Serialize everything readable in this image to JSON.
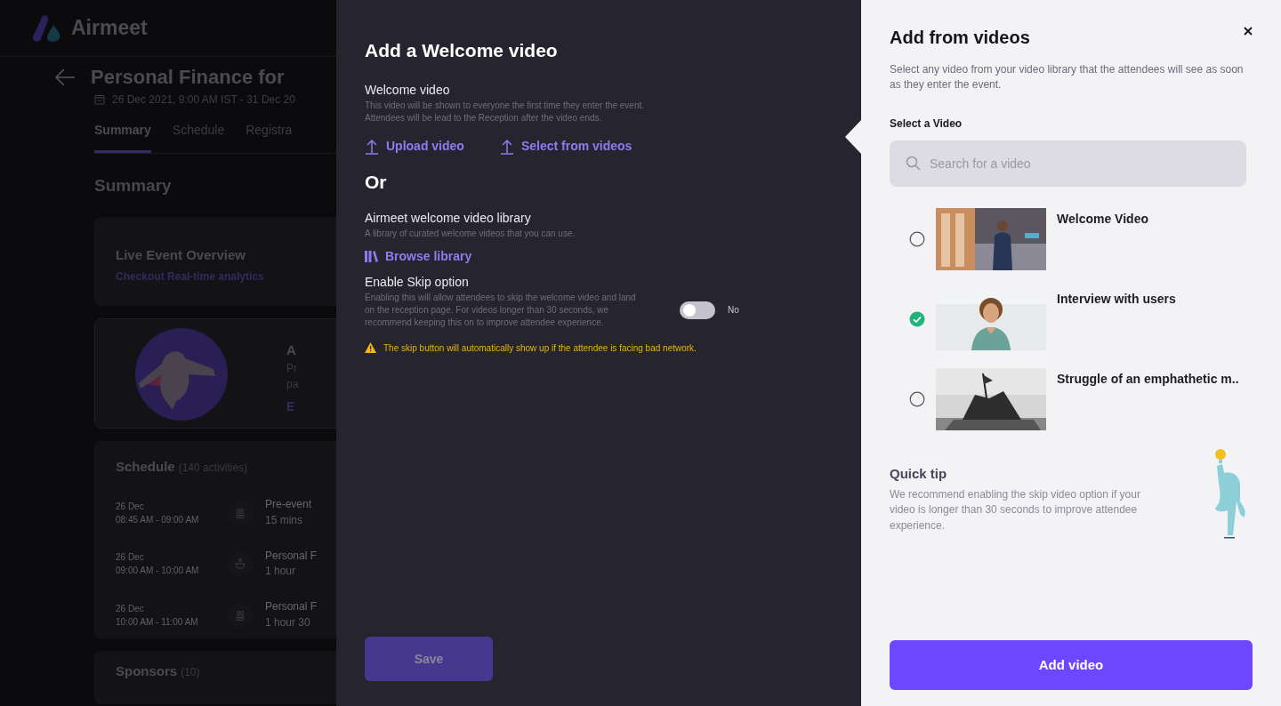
{
  "app": {
    "logo": "Airmeet"
  },
  "event": {
    "title": "Personal Finance for",
    "date": "26 Dec 2021, 9:00 AM IST - 31 Dec 20"
  },
  "tabs": [
    {
      "label": "Summary",
      "selected": true
    },
    {
      "label": "Schedule",
      "selected": false
    },
    {
      "label": "Registra",
      "selected": false
    }
  ],
  "section_title": "Summary",
  "live_card": {
    "title": "Live Event Overview",
    "link": "Checkout Real-time analytics"
  },
  "promo_card": {
    "title": "A",
    "lines": [
      "Pr",
      "pa"
    ],
    "link": "E"
  },
  "schedule": {
    "title": "Schedule",
    "count": "(140 activities)",
    "items": [
      {
        "date": "26 Dec",
        "time": "08:45 AM - 09:00 AM",
        "kind": "group",
        "name": "Pre-event",
        "duration": "15 mins"
      },
      {
        "date": "26 Dec",
        "time": "09:00 AM - 10:00 AM",
        "kind": "speaker",
        "name": "Personal F",
        "duration": "1 hour"
      },
      {
        "date": "26 Dec",
        "time": "10:00 AM - 11:00 AM",
        "kind": "group",
        "name": "Personal F",
        "duration": "1 hour 30"
      }
    ]
  },
  "sponsors": {
    "title": "Sponsors",
    "count": "(10)"
  },
  "welcome": {
    "title": "Add a Welcome video",
    "label": "Welcome video",
    "description": "This video will be shown to everyone the first time they enter the event. Attendees will be lead to the Reception after the video ends.",
    "actions": [
      "Upload video",
      "Select from videos"
    ],
    "or": "Or",
    "library": {
      "label": "Airmeet welcome video library",
      "description": "A library of curated welcome videos that you can use.",
      "action": "Browse library"
    },
    "skip": {
      "label": "Enable Skip option",
      "description": "Enabling this will allow attendees to skip the welcome video and land on the reception page. For videos longer than 30 seconds, we recommend keeping this on to improve attendee experience.",
      "on": false,
      "state_label": "No"
    },
    "warning": "The skip button will automatically show up if the attendee is facing bad network.",
    "save": {
      "label": "Save",
      "disabled": true
    }
  },
  "drawer": {
    "title": "Add from videos",
    "description": "Select any video from your video library that the attendees will see as soon as they enter the event.",
    "select_label": "Select a Video",
    "search": {
      "placeholder": "Search for a video"
    },
    "videos": [
      {
        "title": "Welcome Video",
        "selected": false,
        "kind": "picture"
      },
      {
        "title": "Interview with users",
        "selected": true,
        "kind": "picture"
      },
      {
        "title": "Struggle of an emphathetic m..",
        "selected": false,
        "kind": "picture"
      }
    ],
    "tip": {
      "title": "Quick tip",
      "text": "We recommend enabling the skip video option if your video is longer than 30 seconds to improve attendee experience."
    },
    "button": "Add video"
  }
}
